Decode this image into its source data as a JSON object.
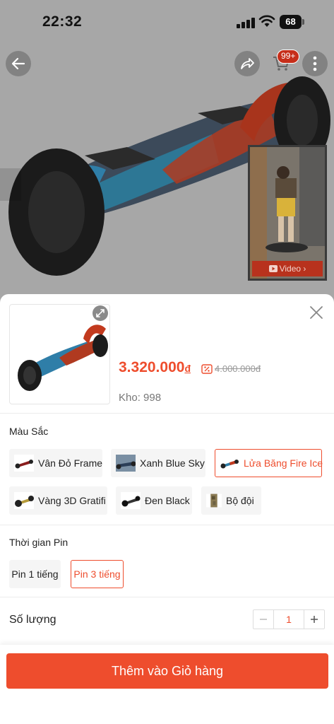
{
  "status_bar": {
    "time": "22:32",
    "battery": "68"
  },
  "product_page": {
    "cart_badge": "99+",
    "video_label": "Video"
  },
  "sheet": {
    "price": "3.320.000",
    "currency": "đ",
    "original_price": "4.000.000đ",
    "stock": "Kho: 998",
    "color_section": {
      "title": "Màu Sắc",
      "options": [
        {
          "label": "Vân Đỏ Frame",
          "selected": false
        },
        {
          "label": "Xanh Blue Sky",
          "selected": false
        },
        {
          "label": "Lửa Băng Fire Ice",
          "selected": true
        },
        {
          "label": "Vàng 3D Gratifi",
          "selected": false
        },
        {
          "label": "Đen Black",
          "selected": false
        },
        {
          "label": "Bộ đội",
          "selected": false
        }
      ]
    },
    "battery_section": {
      "title": "Thời gian Pin",
      "options": [
        {
          "label": "Pin 1 tiếng",
          "selected": false
        },
        {
          "label": "Pin 3 tiếng",
          "selected": true
        }
      ]
    },
    "quantity": {
      "label": "Số lượng",
      "value": "1"
    },
    "add_to_cart_label": "Thêm vào Giỏ hàng"
  },
  "colors": {
    "accent": "#ee4d2d",
    "overlay": "#a7a7a7"
  }
}
